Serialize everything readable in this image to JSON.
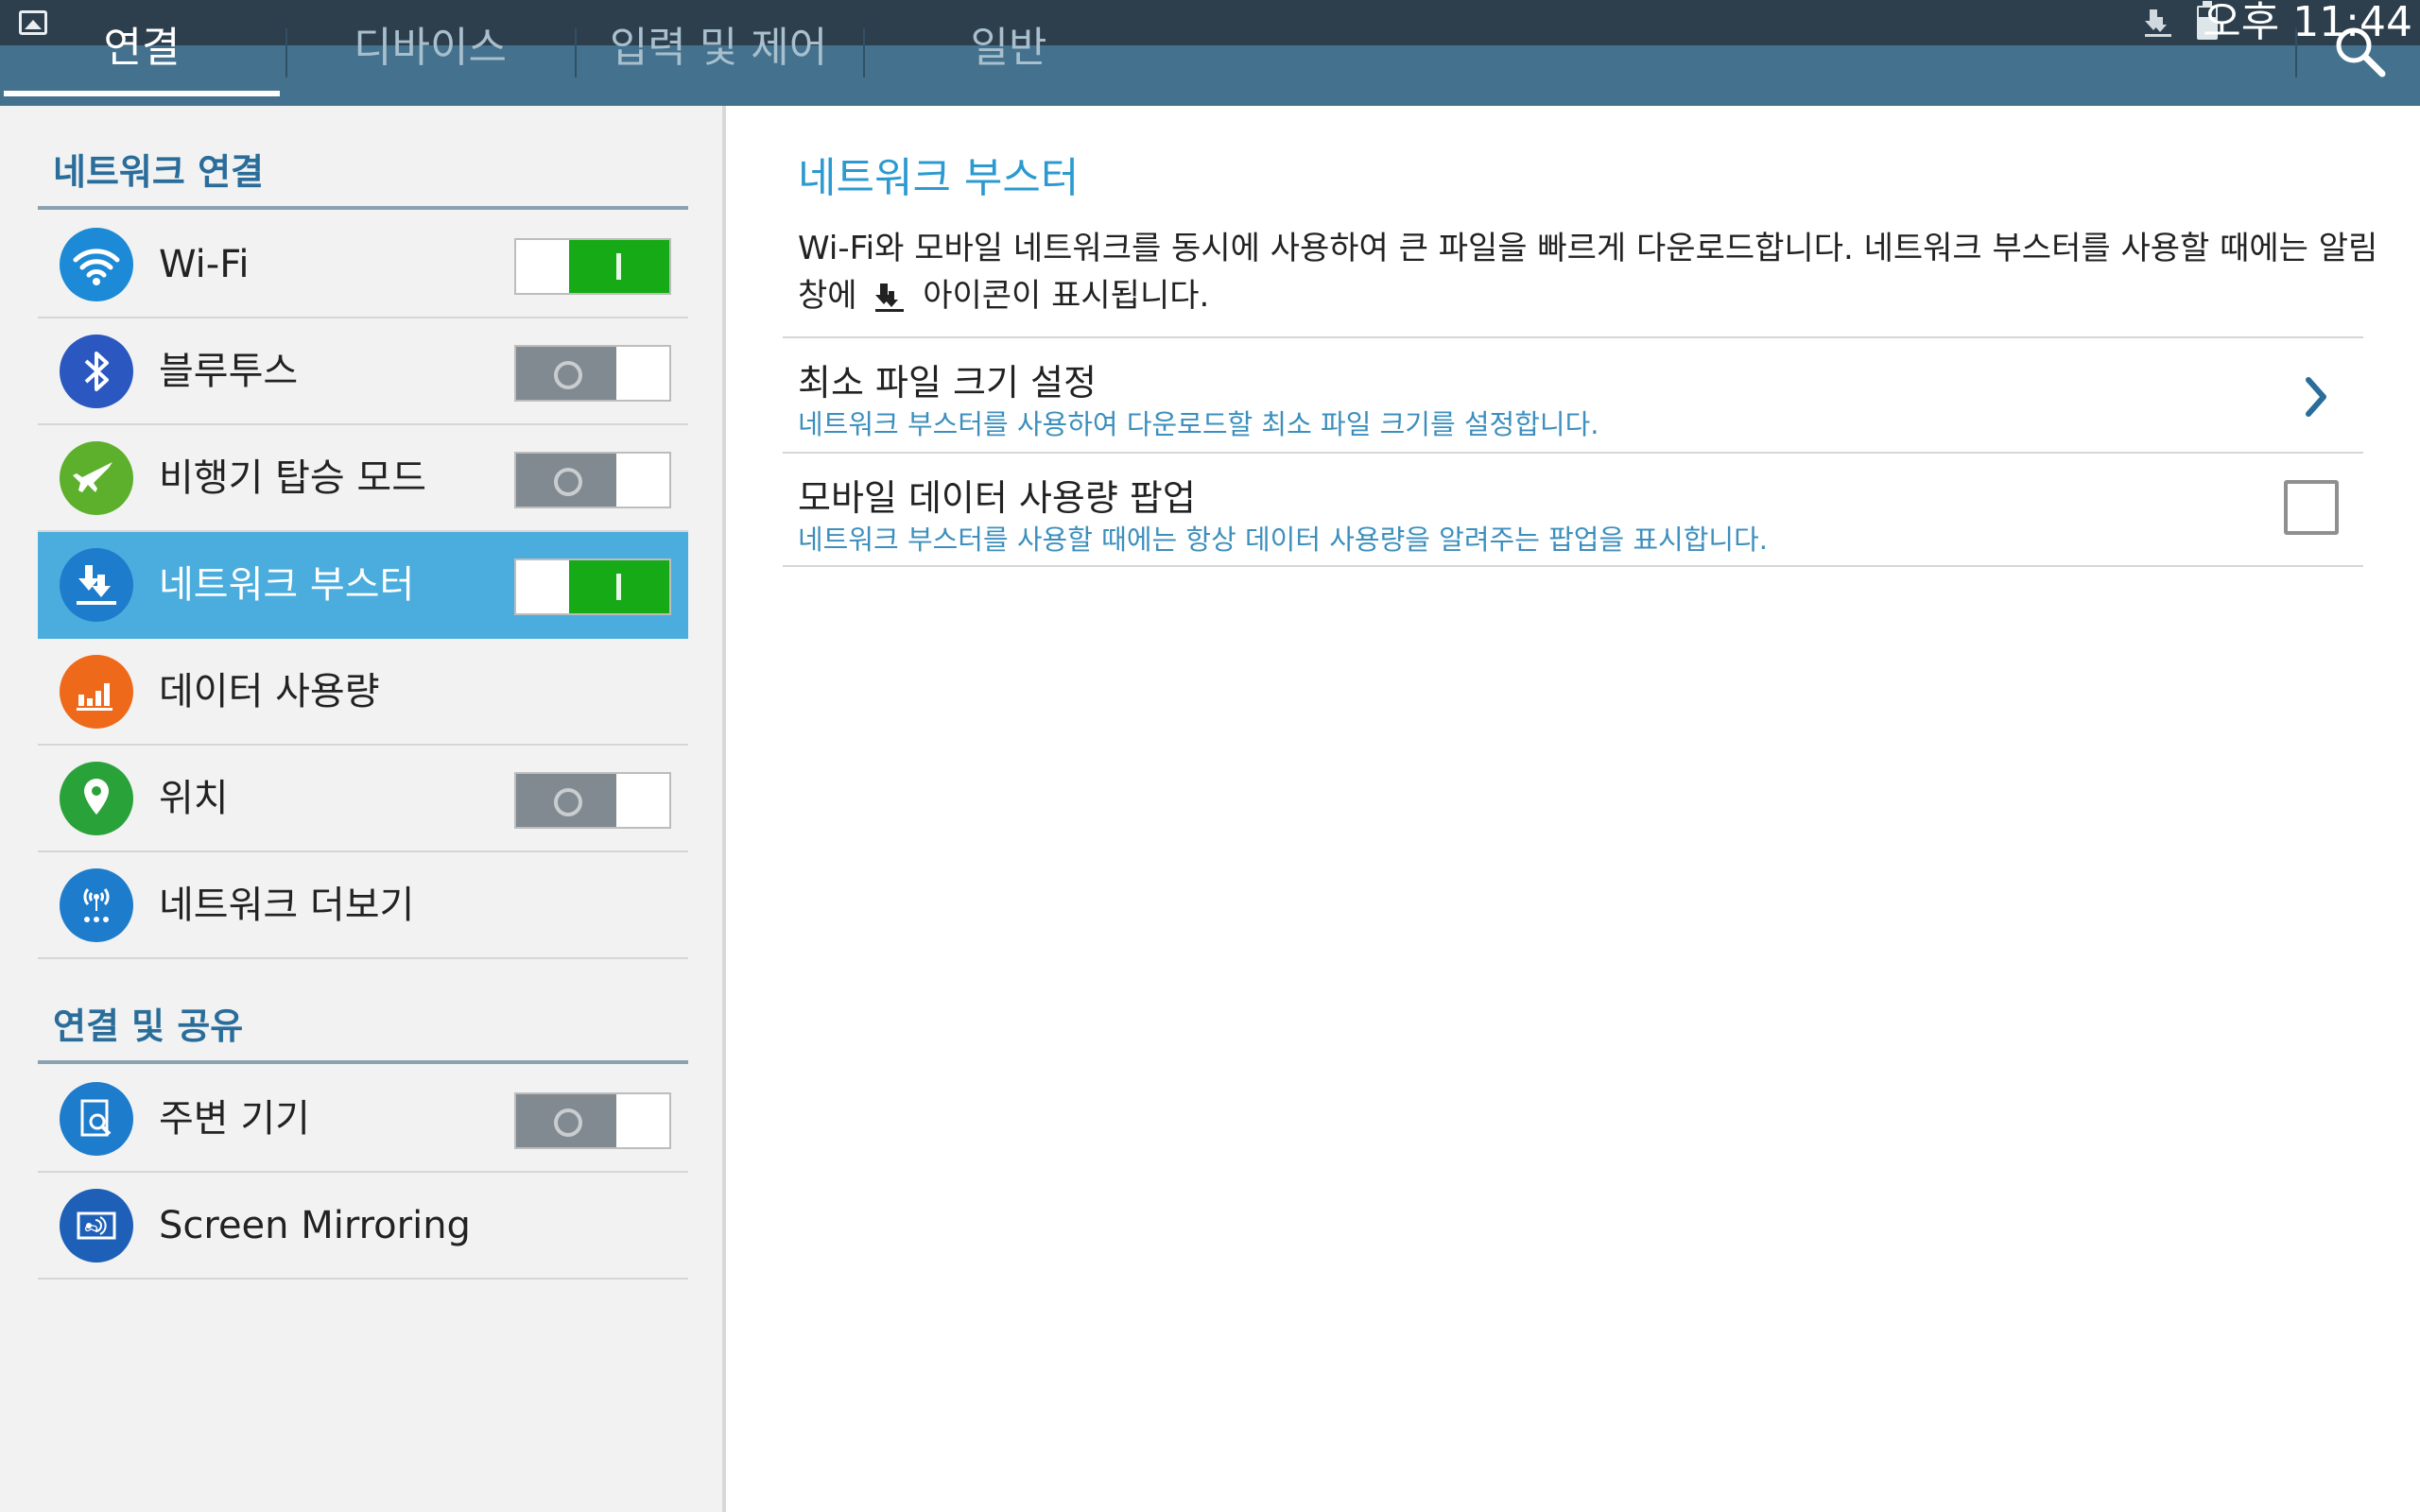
{
  "status_bar": {
    "time": "오후 11:44",
    "notification_icons": [
      "gallery-icon",
      "network-booster-icon",
      "battery-icon"
    ]
  },
  "tabs": [
    {
      "label": "연결",
      "active": true
    },
    {
      "label": "디바이스",
      "active": false
    },
    {
      "label": "입력 및 제어",
      "active": false
    },
    {
      "label": "일반",
      "active": false
    }
  ],
  "sidebar": {
    "section_network": "네트워크 연결",
    "items": [
      {
        "label": "Wi-Fi",
        "icon": "wifi-icon",
        "icon_color": "#1c8ad6",
        "toggle": "on"
      },
      {
        "label": "블루투스",
        "icon": "bluetooth-icon",
        "icon_color": "#2a57c0",
        "toggle": "off"
      },
      {
        "label": "비행기 탑승 모드",
        "icon": "airplane-icon",
        "icon_color": "#5cb02c",
        "toggle": "off"
      },
      {
        "label": "네트워크 부스터",
        "icon": "network-booster-icon",
        "icon_color": "#1e7ccc",
        "toggle": "on",
        "selected": true
      },
      {
        "label": "데이터 사용량",
        "icon": "data-usage-icon",
        "icon_color": "#ee6a1a"
      },
      {
        "label": "위치",
        "icon": "location-icon",
        "icon_color": "#2aa23a",
        "toggle": "off"
      },
      {
        "label": "네트워크 더보기",
        "icon": "more-networks-icon",
        "icon_color": "#1e7ccc"
      }
    ],
    "section_share": "연결 및 공유",
    "share_items": [
      {
        "label": "주변 기기",
        "icon": "nearby-devices-icon",
        "icon_color": "#1e7ccc",
        "toggle": "off"
      },
      {
        "label": "Screen Mirroring",
        "icon": "screen-mirroring-icon",
        "icon_color": "#1e60b8"
      }
    ]
  },
  "detail": {
    "title": "네트워크 부스터",
    "description_part1": "Wi-Fi와 모바일 네트워크를 동시에 사용하여 큰 파일을 빠르게 다운로드합니다. 네트워크 부스터를 사용할 때에는 알림창에",
    "description_part2": "아이콘이 표시됩니다.",
    "rows": [
      {
        "title": "최소 파일 크기 설정",
        "subtitle": "네트워크 부스터를 사용하여 다운로드할 최소 파일 크기를 설정합니다."
      },
      {
        "title": "모바일 데이터 사용량 팝업",
        "subtitle": "네트워크 부스터를 사용할 때에는 항상 데이터 사용량을 알려주는 팝업을 표시합니다.",
        "checked": false
      }
    ]
  },
  "colors": {
    "status_bar": "#2d3e4c",
    "tab_bar": "#44718d",
    "accent": "#2c9ad0",
    "selected_row": "#4aaddd",
    "toggle_on": "#16ab16",
    "toggle_off": "#808a90"
  }
}
